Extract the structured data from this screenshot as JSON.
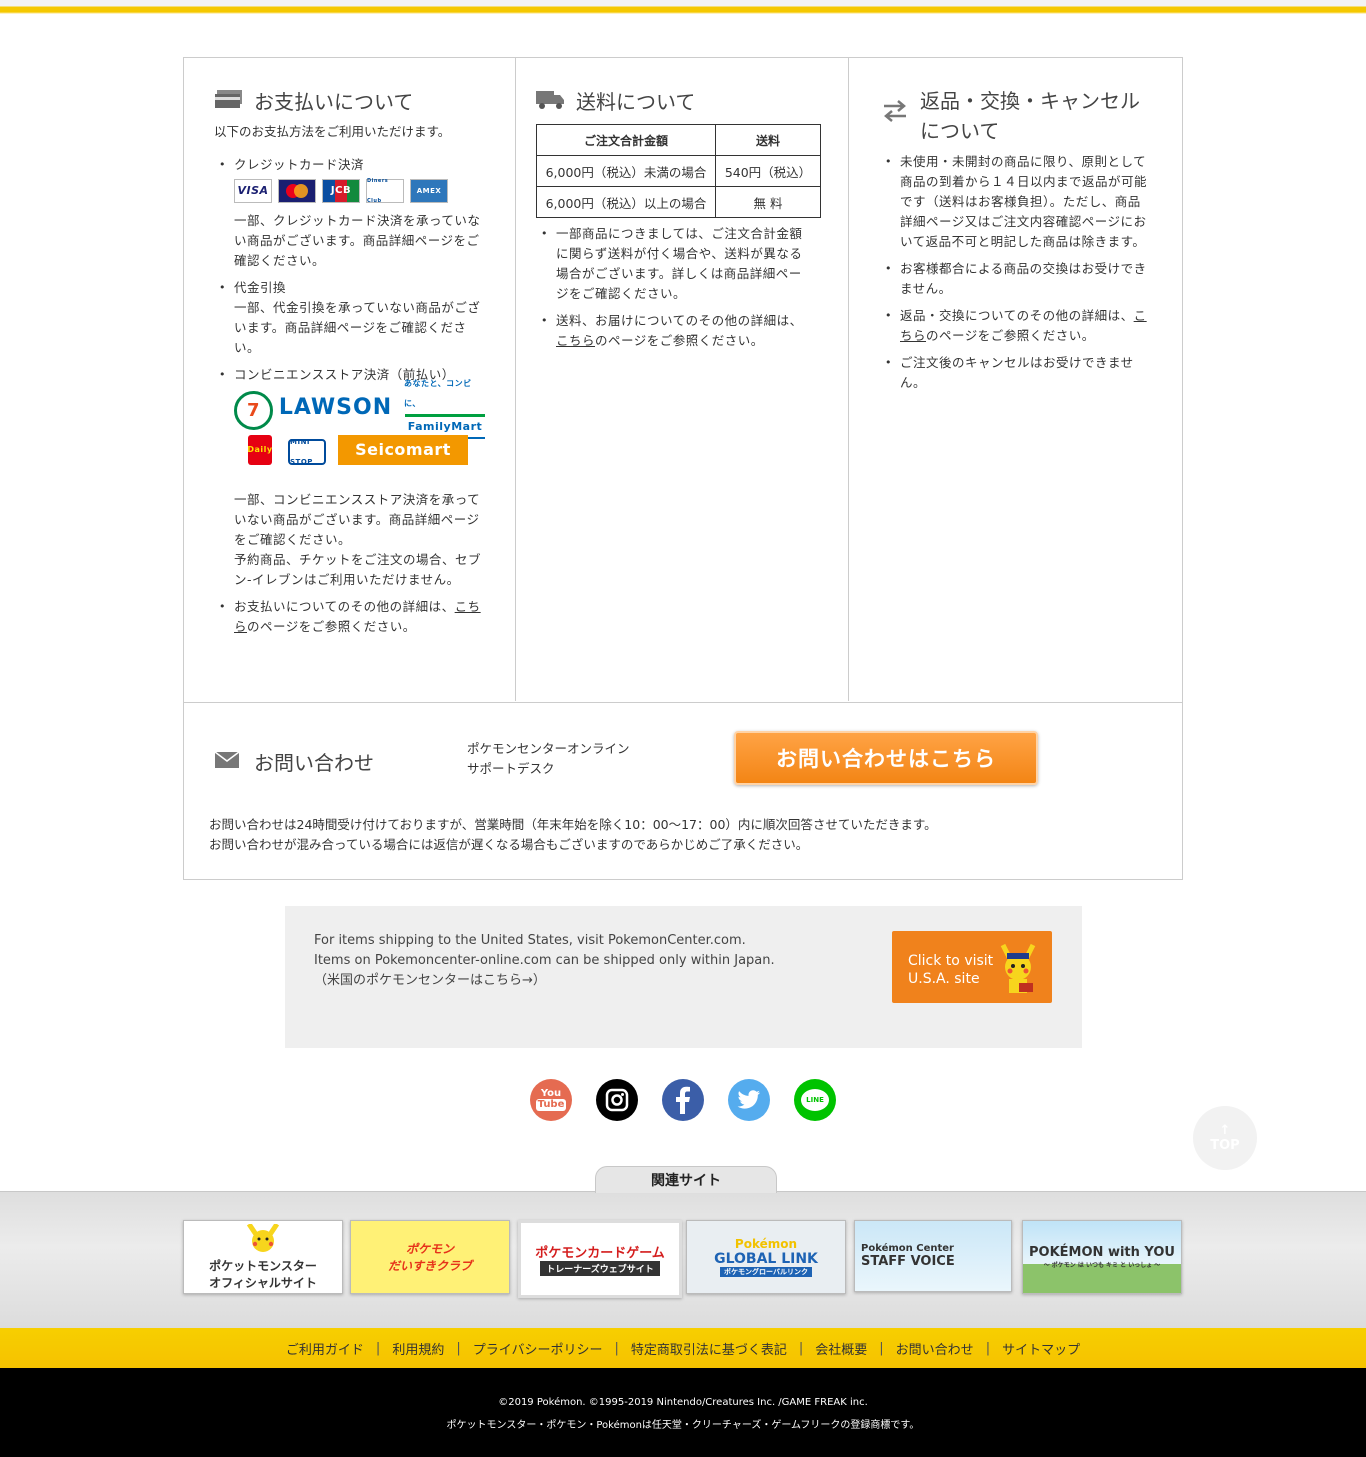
{
  "payment": {
    "title": "お支払いについて",
    "lead": "以下のお支払方法をご利用いただけます。",
    "credit_label": "クレジットカード決済",
    "cards": [
      "VISA",
      "MasterCard",
      "JCB",
      "Diners Club",
      "AMEX"
    ],
    "credit_note": "一部、クレジットカード決済を承っていない商品がございます。商品詳細ページをご確認ください。",
    "cod_label": "代金引換",
    "cod_note": "一部、代金引換を承っていない商品がございます。商品詳細ページをご確認ください。",
    "conv_label": "コンビニエンスストア決済（前払い）",
    "stores": [
      "7-ELEVEn",
      "LAWSON",
      "あなたと、コンビに、",
      "FamilyMart",
      "Daily",
      "MINI STOP",
      "Seicomart"
    ],
    "conv_note1": "一部、コンビニエンスストア決済を承っていない商品がございます。商品詳細ページをご確認ください。",
    "conv_note2": "予約商品、チケットをご注文の場合、セブン-イレブンはご利用いただけません。",
    "detail_pre": "お支払いについてのその他の詳細は、",
    "detail_link": "こちら",
    "detail_post": "のページをご参照ください。"
  },
  "shipping": {
    "title": "送料について",
    "headers": [
      "ご注文合計金額",
      "送料"
    ],
    "rows": [
      [
        "6,000円（税込）未満の場合",
        "540円（税込）"
      ],
      [
        "6,000円（税込）以上の場合",
        "無 料"
      ]
    ],
    "note1": "一部商品につきましては、ご注文合計金額に関らず送料が付く場合や、送料が異なる場合がございます。詳しくは商品詳細ページをご確認ください。",
    "detail_pre": "送料、お届けについてのその他の詳細は、",
    "detail_link": "こちら",
    "detail_post": "のページをご参照ください。"
  },
  "returns": {
    "title_line1": "返品・交換・キャンセル",
    "title_line2": "について",
    "item1": "未使用・未開封の商品に限り、原則として商品の到着から１４日以内まで返品が可能です（送料はお客様負担）。ただし、商品詳細ページ又はご注文内容確認ページにおいて返品不可と明記した商品は除きます。",
    "item2": "お客様都合による商品の交換はお受けできません。",
    "detail_pre": "返品・交換についてのその他の詳細は、",
    "detail_link": "こちら",
    "detail_post": "のページをご参照ください。",
    "item4": "ご注文後のキャンセルはお受けできません。"
  },
  "contact": {
    "title": "お問い合わせ",
    "desk_line1": "ポケモンセンターオンライン",
    "desk_line2": "サポートデスク",
    "button": "お問い合わせはこちら",
    "note1": "お問い合わせは24時間受け付けておりますが、営業時間（年末年始を除く10：00〜17：00）内に順次回答させていただきます。",
    "note2": "お問い合わせが混み合っている場合には返信が遅くなる場合もございますのであらかじめご了承ください。"
  },
  "us": {
    "line1": "For items shipping to the United States, visit PokemonCenter.com.",
    "line2": "Items on Pokemoncenter-online.com can be shipped only within Japan.",
    "line3": "（米国のポケモンセンターはこちら→）",
    "btn_line1": "Click to visit",
    "btn_line2": "U.S.A. site"
  },
  "social": {
    "youtube_top": "You",
    "youtube_bottom": "Tube",
    "line": "LINE"
  },
  "totop": {
    "arrow": "↑",
    "label": "TOP"
  },
  "related": {
    "title": "関連サイト",
    "banners": [
      {
        "line1": "ポケットモンスター",
        "line2": "オフィシャルサイト"
      },
      {
        "line1": "ポケモン",
        "line2": "だいすきクラブ"
      },
      {
        "line1": "ポケモンカードゲーム",
        "line2": "トレーナーズウェブサイト"
      },
      {
        "line1": "Pokémon",
        "line2": "GLOBAL LINK",
        "line3": "ポケモングローバルリンク"
      },
      {
        "line1": "Pokémon Center",
        "line2": "STAFF VOICE"
      },
      {
        "line1": "POKÉMON with YOU",
        "line2": "～ ポケモン は いつも キミ と いっしょ ～"
      }
    ]
  },
  "footer_nav": [
    "ご利用ガイド",
    "利用規約",
    "プライバシーポリシー",
    "特定商取引法に基づく表記",
    "会社概要",
    "お問い合わせ",
    "サイトマップ"
  ],
  "footer_sep": "|",
  "copyright": {
    "line1": "©2019 Pokémon. ©1995-2019 Nintendo/Creatures Inc. /GAME FREAK inc.",
    "line2": "ポケットモンスター・ポケモン・Pokémonは任天堂・クリーチャーズ・ゲームフリークの登録商標です。"
  }
}
